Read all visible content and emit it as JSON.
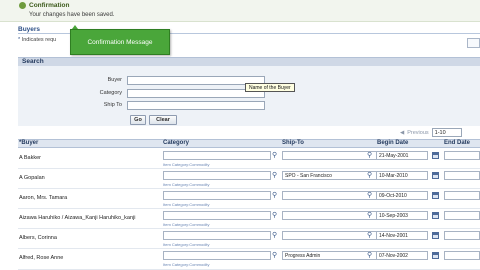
{
  "confirmation": {
    "title": "Confirmation",
    "message": "Your changes have been saved."
  },
  "page": {
    "title": "Buyers",
    "indicates_required": "Indicates requ"
  },
  "popup": {
    "message": "Confirmation Message"
  },
  "search": {
    "header": "Search",
    "fields": [
      {
        "label": "Buyer",
        "value": ""
      },
      {
        "label": "Category",
        "value": ""
      },
      {
        "label": "Ship To",
        "value": ""
      }
    ],
    "go_label": "Go",
    "clear_label": "Clear",
    "tooltip": "Name of the Buyer"
  },
  "pagination": {
    "previous_label": "Previous",
    "range": "1-10"
  },
  "table": {
    "columns": [
      "Buyer",
      "Category",
      "Ship-To",
      "Begin Date",
      "End Date"
    ],
    "category_hint": "Item Category:Commodity",
    "rows": [
      {
        "buyer": "A Bakker",
        "ship_to": "",
        "begin_date": "21-May-2001"
      },
      {
        "buyer": "A Gopalan",
        "ship_to": "SPO - San Francisco",
        "begin_date": "10-Mar-2010"
      },
      {
        "buyer": "Aaron, Mrs. Tamara",
        "ship_to": "",
        "begin_date": "09-Oct-2010"
      },
      {
        "buyer": "Aizawa Haruhiko / Aizawa_Kanji Haruhiko_kanji",
        "ship_to": "",
        "begin_date": "10-Sep-2003"
      },
      {
        "buyer": "Albers, Corinna",
        "ship_to": "",
        "begin_date": "14-Nov-2001"
      },
      {
        "buyer": "Alfred, Rose Anne",
        "ship_to": "Progress Admin",
        "begin_date": "07-Nov-2002"
      }
    ]
  },
  "colors": {
    "confirm_green": "#4aa63a",
    "header_blue": "#2c4f86",
    "panel_bg": "#eef2f7"
  }
}
